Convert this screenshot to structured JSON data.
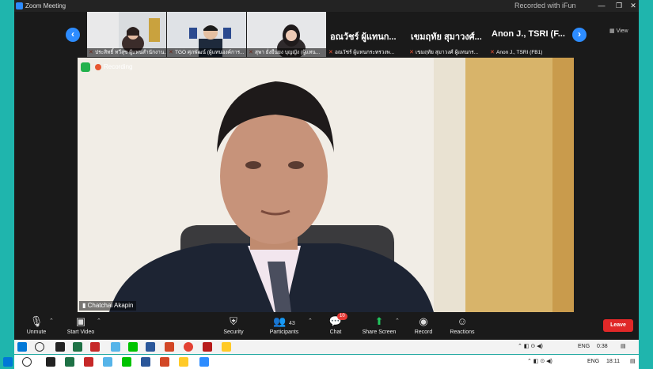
{
  "titlebar": {
    "title": "Zoom Meeting",
    "recorded_text": "Recorded with iFun",
    "minimize": "—",
    "restore": "❐",
    "close": "✕"
  },
  "gallery": {
    "prev": "‹",
    "next": "›",
    "view_label": "View",
    "video_tiles": [
      {
        "name": "ประสิทธิ์ ทวีสุข ผู้แทนสำนักงาน..."
      },
      {
        "name": "TGO ศุภพัฒน์ (ผู้แทนองค์การ..."
      },
      {
        "name": "สุพา ยั่งยืนยง บุญญัง (ผู้แทน..."
      }
    ],
    "name_tiles": [
      {
        "big": "อณวัชร์ ผู้แทนก...",
        "name": "อณวัชร์ ผู้แทนกระทรวงพ..."
      },
      {
        "big": "เขมฤทัย สุมาวงศ์...",
        "name": "เขมฤทัย สุมาวงศ์ ผู้แทนกร..."
      },
      {
        "big": "Anon J., TSRI (F...",
        "name": "Anon J., TSRI (FB1)"
      }
    ]
  },
  "main": {
    "recording_label": "Recording",
    "speaker_name": "Chatchai Akapin"
  },
  "toolbar": {
    "unmute": "Unmute",
    "start_video": "Start Video",
    "security": "Security",
    "participants": "Participants",
    "participants_count": "43",
    "chat": "Chat",
    "chat_badge": "10",
    "share_screen": "Share Screen",
    "record": "Record",
    "reactions": "Reactions",
    "leave": "Leave"
  },
  "taskbar_inner": {
    "lang": "ENG",
    "time": "0:38"
  },
  "taskbar_outer": {
    "lang": "ENG",
    "time": "18:11"
  },
  "colors": {
    "desktop_teal": "#1fb5ad",
    "zoom_blue": "#2d8cff",
    "leave_red": "#e02828",
    "recording_orange": "#e8562f"
  }
}
